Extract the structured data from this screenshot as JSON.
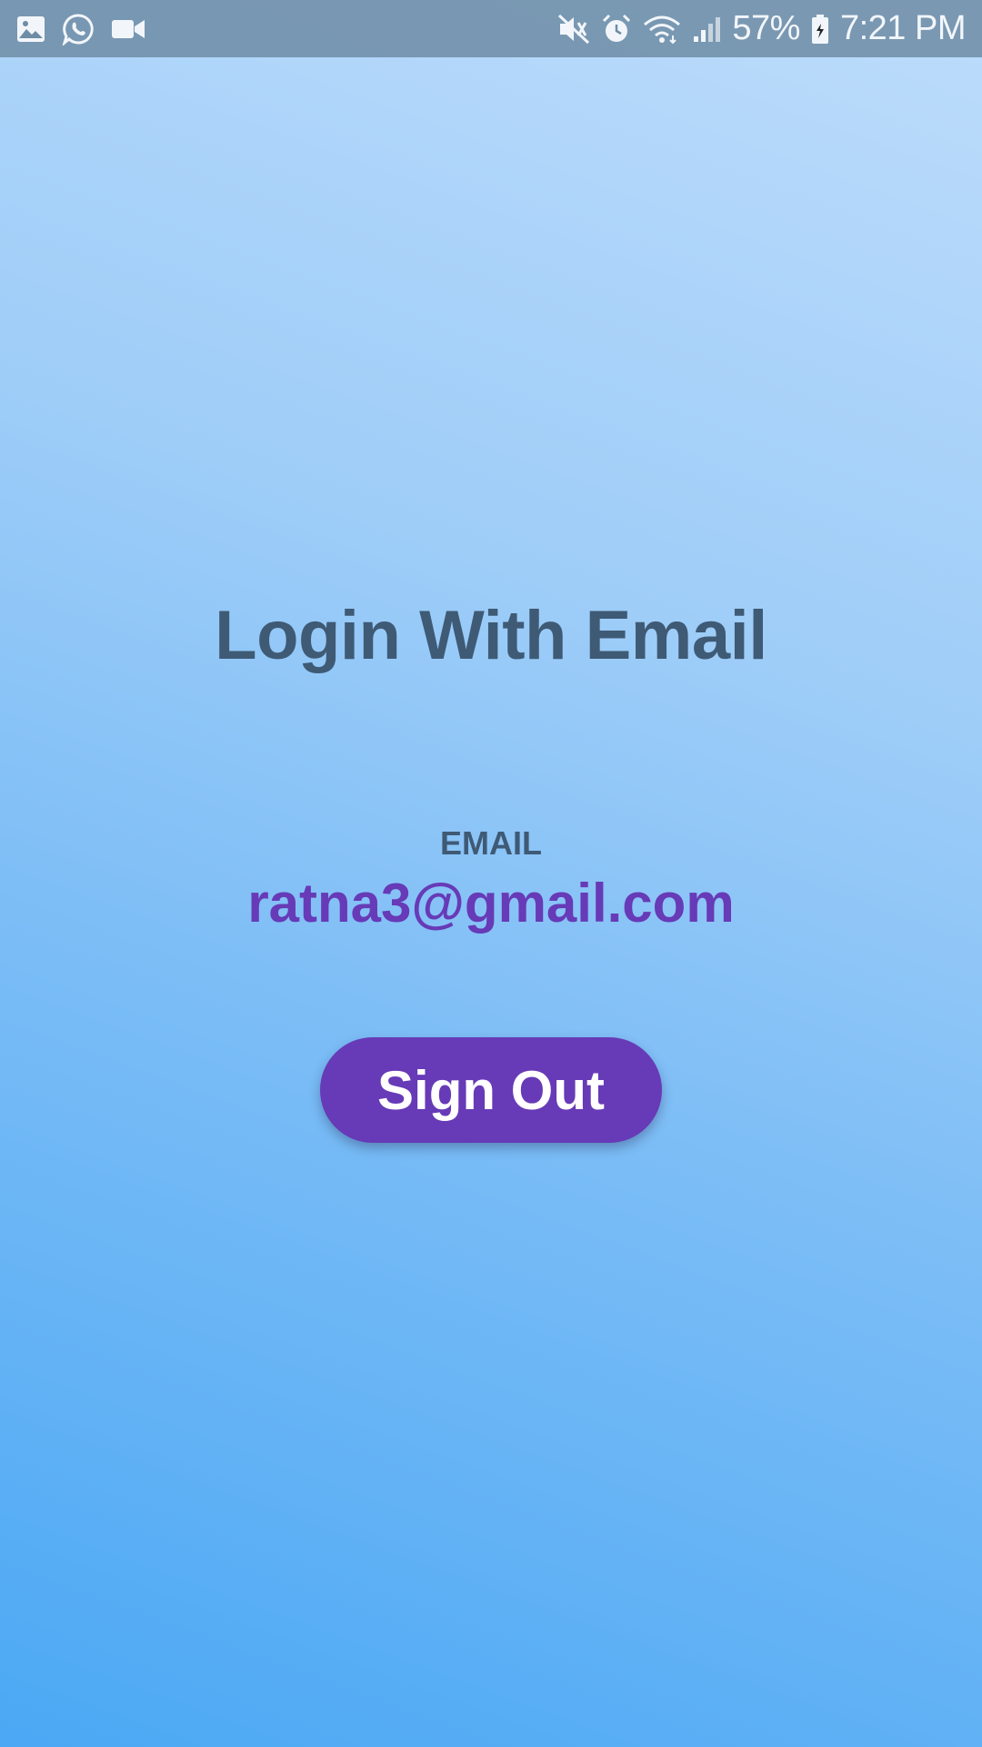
{
  "status_bar": {
    "left_icons": [
      "gallery-icon",
      "whatsapp-icon",
      "video-camera-icon"
    ],
    "right_icons": [
      "mute-vibrate-icon",
      "alarm-icon",
      "wifi-icon",
      "signal-icon",
      "battery-icon"
    ],
    "battery_percent": "57%",
    "time": "7:21 PM",
    "color": "#f2f6fa"
  },
  "main": {
    "title": "Login With Email",
    "email_label": "EMAIL",
    "email_value": "ratna3@gmail.com",
    "sign_out_label": "Sign Out"
  },
  "colors": {
    "accent": "#673ab7",
    "heading": "#3f5a75",
    "background_top": "#bddcfb",
    "background_bottom": "#4ba8f4"
  }
}
